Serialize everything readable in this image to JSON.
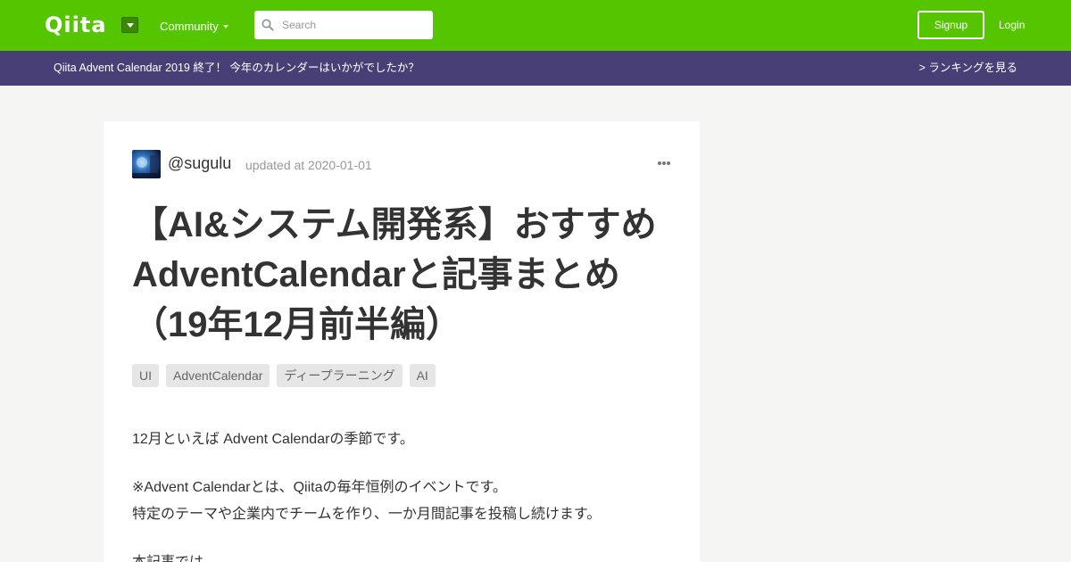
{
  "header": {
    "logo": "Qiita",
    "community_label": "Community",
    "search_placeholder": "Search",
    "signup_label": "Signup",
    "login_label": "Login",
    "brand_color": "#55c500"
  },
  "banner": {
    "text": "Qiita Advent Calendar 2019 終了！ 今年のカレンダーはいかがでしたか？",
    "link": "> ランキングを見る",
    "color": "#483f77"
  },
  "article": {
    "author": "@sugulu",
    "updated": "updated at 2020-01-01",
    "title": "【AI&システム開発系】おすすめAdventCalendarと記事まとめ（19年12月前半編）",
    "tags": [
      "UI",
      "AdventCalendar",
      "ディープラーニング",
      "AI"
    ],
    "paragraphs": [
      "12月といえば Advent Calendarの季節です。",
      "※Advent Calendarとは、Qiitaの毎年恒例のイベントです。",
      "特定のテーマや企業内でチームを作り、一か月間記事を投稿し続けます。",
      "本記事では"
    ]
  }
}
